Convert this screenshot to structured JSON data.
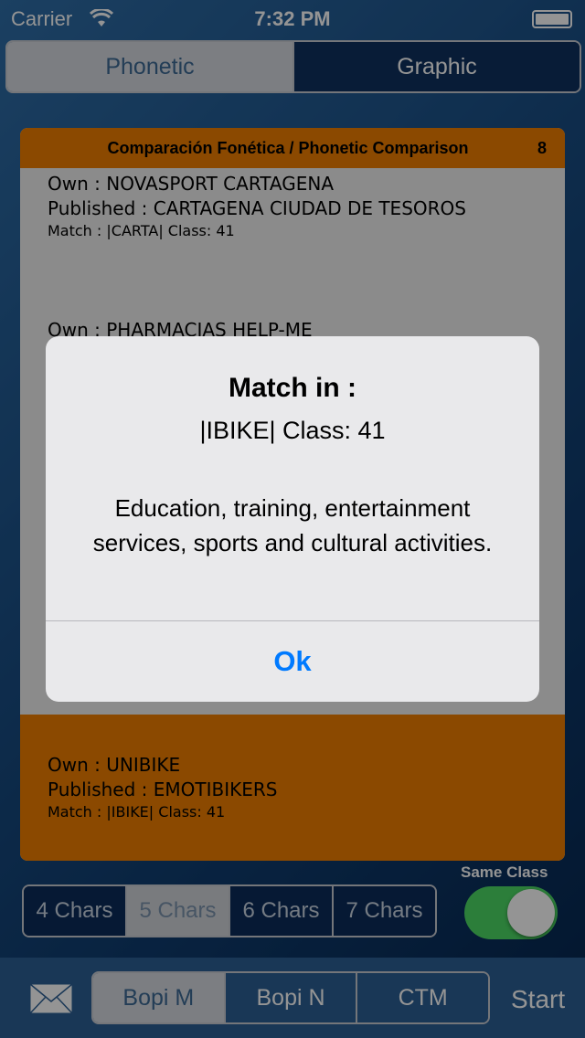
{
  "status_bar": {
    "carrier": "Carrier",
    "time": "7:32 PM"
  },
  "mode_tabs": [
    {
      "label": "Phonetic",
      "selected": true
    },
    {
      "label": "Graphic",
      "selected": false
    }
  ],
  "list": {
    "title": "Comparación Fonética / Phonetic Comparison",
    "count": "8",
    "rows": [
      {
        "own": "Own : NOVASPORT CARTAGENA",
        "published": "Published : CARTAGENA CIUDAD DE TESOROS",
        "match": "Match : |CARTA| Class: 41",
        "selected": false
      },
      {
        "own": "Own : PHARMACIAS HELP-ME",
        "published": "",
        "match": "",
        "selected": false
      },
      {
        "own": "Own : UNIBIKE",
        "published": "Published : EMOTIBIKERS",
        "match": "Match : |IBIKE| Class: 41",
        "selected": true
      }
    ]
  },
  "char_tabs": [
    {
      "label": "4 Chars",
      "selected": false
    },
    {
      "label": "5 Chars",
      "selected": true
    },
    {
      "label": "6 Chars",
      "selected": false
    },
    {
      "label": "7 Chars",
      "selected": false
    }
  ],
  "same_class": {
    "label": "Same Class",
    "on": true
  },
  "bottom": {
    "source_tabs": [
      {
        "label": "Bopi M",
        "selected": true
      },
      {
        "label": "Bopi N",
        "selected": false
      },
      {
        "label": "CTM",
        "selected": false
      }
    ],
    "start_label": "Start",
    "mail_icon": "envelope-icon"
  },
  "alert": {
    "title": "Match in :",
    "subtitle": "|IBIKE| Class: 41",
    "message": "Education, training, entertainment services, sports and cultural activities.",
    "ok_label": "Ok"
  },
  "colors": {
    "accent_orange": "#f07f00",
    "toggle_green": "#4cd964",
    "ios_blue": "#007aff"
  }
}
